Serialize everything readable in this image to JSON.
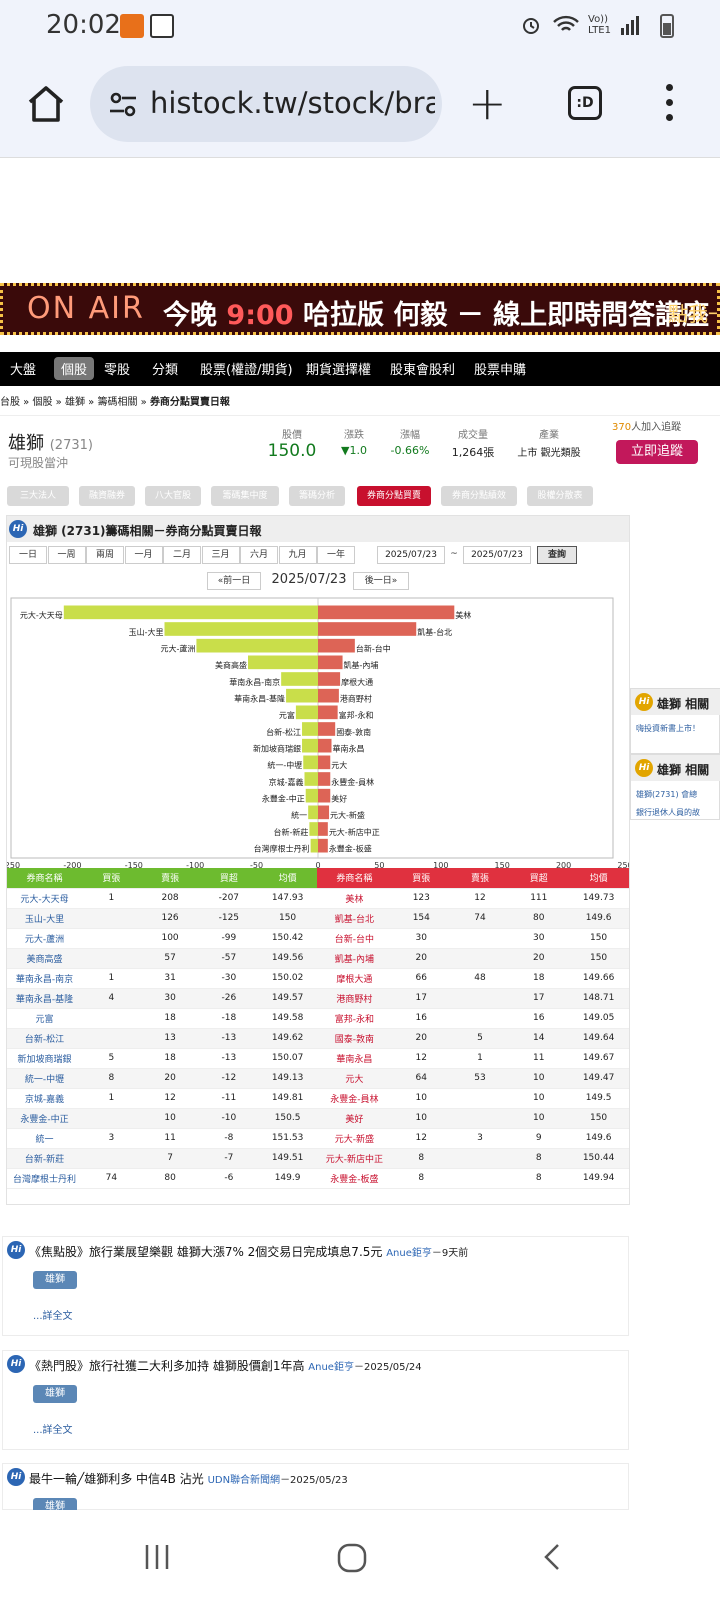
{
  "status": {
    "time": "20:02",
    "network_label": "Vo)) LTE1"
  },
  "browser": {
    "url": "histock.tw/stock/bra",
    "tabs_label": ":D"
  },
  "banner": {
    "onair": "ON AIR",
    "text_pre": "今晚 ",
    "text_time": "9:00",
    "text_post": " 哈拉版  何毅 － 線上即時問答講座",
    "cta": "點我一"
  },
  "nav": [
    "大盤",
    "個股",
    "零股",
    "分類",
    "股票(權證/期貨)",
    "期貨選擇權",
    "股東會股利",
    "股票申購"
  ],
  "nav_active": 1,
  "breadcrumb": {
    "items": [
      "台股",
      "個股",
      "雄獅",
      "籌碼相關"
    ],
    "current": "券商分點買賣日報",
    "sep": " » "
  },
  "stock": {
    "name": "雄獅",
    "code": "(2731)",
    "sub": "可現股當沖",
    "price_label": "股價",
    "price": "150.0",
    "change_label": "漲跌",
    "change": "▼1.0",
    "pct_label": "漲幅",
    "pct": "-0.66%",
    "vol_label": "成交量",
    "vol": "1,264張",
    "ind_label": "產業",
    "ind": "上市 觀光類股",
    "track_count": "370",
    "track_suffix": "人加入追蹤",
    "follow": "立即追蹤"
  },
  "subtabs": [
    "三大法人",
    "融資融券",
    "八大官股",
    "籌碼集中度",
    "籌碼分析",
    "券商分點買賣",
    "券商分點績效",
    "股權分散表"
  ],
  "subtab_active": 5,
  "panel": {
    "hi": "Hi",
    "title": "雄獅 (2731)籌碼相關－券商分點買賣日報",
    "ranges": [
      "一日",
      "一周",
      "兩周",
      "一月",
      "二月",
      "三月",
      "六月",
      "九月",
      "一年"
    ],
    "date_from": "2025/07/23",
    "tilde": "~",
    "date_to": "2025/07/23",
    "query": "查詢",
    "prev": "«前一日",
    "current_date": "2025/07/23",
    "next": "後一日»"
  },
  "chart_data": {
    "type": "bar",
    "orientation": "horizontal-diverging",
    "xlim": [
      -250,
      250
    ],
    "ticks": [
      -250,
      -200,
      -150,
      -100,
      -50,
      0,
      50,
      100,
      150,
      200,
      250
    ],
    "colors": {
      "sell": "#c9de4a",
      "buy": "#dd6456"
    },
    "sell_side": [
      {
        "name": "元大-大天母",
        "value": -207
      },
      {
        "name": "玉山-大里",
        "value": -125
      },
      {
        "name": "元大-蘆洲",
        "value": -99
      },
      {
        "name": "美商高盛",
        "value": -57
      },
      {
        "name": "華南永昌-南京",
        "value": -30
      },
      {
        "name": "華南永昌-基隆",
        "value": -26
      },
      {
        "name": "元富",
        "value": -18
      },
      {
        "name": "台新-松江",
        "value": -13
      },
      {
        "name": "新加坡商瑞銀",
        "value": -13
      },
      {
        "name": "統一-中壢",
        "value": -12
      },
      {
        "name": "京城-嘉義",
        "value": -11
      },
      {
        "name": "永豐金-中正",
        "value": -10
      },
      {
        "name": "統一",
        "value": -8
      },
      {
        "name": "台新-新莊",
        "value": -7
      },
      {
        "name": "台灣摩根士丹利",
        "value": -6
      }
    ],
    "buy_side": [
      {
        "name": "美林",
        "value": 111
      },
      {
        "name": "凱基-台北",
        "value": 80
      },
      {
        "name": "台新-台中",
        "value": 30
      },
      {
        "name": "凱基-內埔",
        "value": 20
      },
      {
        "name": "摩根大通",
        "value": 18
      },
      {
        "name": "港商野村",
        "value": 17
      },
      {
        "name": "富邦-永和",
        "value": 16
      },
      {
        "name": "國泰-敦南",
        "value": 14
      },
      {
        "name": "華南永昌",
        "value": 11
      },
      {
        "name": "元大",
        "value": 10
      },
      {
        "name": "永豐金-員林",
        "value": 10
      },
      {
        "name": "美好",
        "value": 10
      },
      {
        "name": "元大-新盛",
        "value": 9
      },
      {
        "name": "元大-新店中正",
        "value": 8
      },
      {
        "name": "永豐金-板盛",
        "value": 8
      }
    ]
  },
  "table": {
    "headers": [
      "券商名稱",
      "買張",
      "賣張",
      "買超",
      "均價",
      "券商名稱",
      "買張",
      "賣張",
      "買超",
      "均價"
    ],
    "rows": [
      [
        "元大-大天母",
        "1",
        "208",
        "-207",
        "147.93",
        "美林",
        "123",
        "12",
        "111",
        "149.73"
      ],
      [
        "玉山-大里",
        "",
        "126",
        "-125",
        "150",
        "凱基-台北",
        "154",
        "74",
        "80",
        "149.6"
      ],
      [
        "元大-蘆洲",
        "",
        "100",
        "-99",
        "150.42",
        "台新-台中",
        "30",
        "",
        "30",
        "150"
      ],
      [
        "美商高盛",
        "",
        "57",
        "-57",
        "149.56",
        "凱基-內埔",
        "20",
        "",
        "20",
        "150"
      ],
      [
        "華南永昌-南京",
        "1",
        "31",
        "-30",
        "150.02",
        "摩根大通",
        "66",
        "48",
        "18",
        "149.66"
      ],
      [
        "華南永昌-基隆",
        "4",
        "30",
        "-26",
        "149.57",
        "港商野村",
        "17",
        "",
        "17",
        "148.71"
      ],
      [
        "元富",
        "",
        "18",
        "-18",
        "149.58",
        "富邦-永和",
        "16",
        "",
        "16",
        "149.05"
      ],
      [
        "台新-松江",
        "",
        "13",
        "-13",
        "149.62",
        "國泰-敦南",
        "20",
        "5",
        "14",
        "149.64"
      ],
      [
        "新加坡商瑞銀",
        "5",
        "18",
        "-13",
        "150.07",
        "華南永昌",
        "12",
        "1",
        "11",
        "149.67"
      ],
      [
        "統一-中壢",
        "8",
        "20",
        "-12",
        "149.13",
        "元大",
        "64",
        "53",
        "10",
        "149.47"
      ],
      [
        "京城-嘉義",
        "1",
        "12",
        "-11",
        "149.81",
        "永豐金-員林",
        "10",
        "",
        "10",
        "149.5"
      ],
      [
        "永豐金-中正",
        "",
        "10",
        "-10",
        "150.5",
        "美好",
        "10",
        "",
        "10",
        "150"
      ],
      [
        "統一",
        "3",
        "11",
        "-8",
        "151.53",
        "元大-新盛",
        "12",
        "3",
        "9",
        "149.6"
      ],
      [
        "台新-新莊",
        "",
        "7",
        "-7",
        "149.51",
        "元大-新店中正",
        "8",
        "",
        "8",
        "150.44"
      ],
      [
        "台灣摩根士丹利",
        "74",
        "80",
        "-6",
        "149.9",
        "永豐金-板盛",
        "8",
        "",
        "8",
        "149.94"
      ]
    ]
  },
  "side": [
    {
      "title": "雄獅 相關",
      "lines": [
        "嗨投資新書上市！"
      ]
    },
    {
      "title": "雄獅 相關",
      "lines": [
        "雄獅(2731) 會總",
        "銀行退休人員的故"
      ]
    }
  ],
  "news": [
    {
      "title": "《焦點股》旅行業展望樂觀 雄獅大漲7% 2個交易日完成填息7.5元",
      "source": "Anue鉅亨",
      "meta": "－9天前",
      "tag": "雄獅",
      "more": "...詳全文"
    },
    {
      "title": "《熱門股》旅行社獲二大利多加持 雄獅股價創1年高",
      "source": "Anue鉅亨",
      "meta": "－2025/05/24",
      "tag": "雄獅",
      "more": "...詳全文"
    },
    {
      "title": "最牛一輪╱雄獅利多 中信4B 沾光",
      "source": "UDN聯合新聞網",
      "meta": "－2025/05/23",
      "tag": "雄獅",
      "more": ""
    }
  ]
}
